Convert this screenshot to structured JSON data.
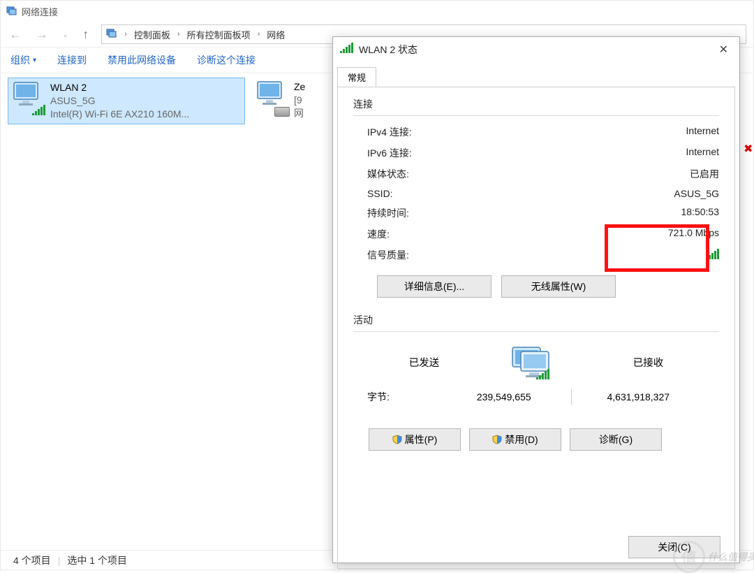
{
  "window": {
    "title": "网络连接",
    "breadcrumb": [
      "控制面板",
      "所有控制面板项",
      "网络"
    ]
  },
  "toolbar": {
    "organize": "组织",
    "connect": "连接到",
    "disable": "禁用此网络设备",
    "diagnose": "诊断这个连接"
  },
  "items": [
    {
      "name": "WLAN 2",
      "ssid": "ASUS_5G",
      "adapter": "Intel(R) Wi-Fi 6E AX210 160M...",
      "selected": true,
      "type": "wifi"
    },
    {
      "name": "Ze",
      "sub1": "[9",
      "sub2": "网",
      "selected": false,
      "type": "eth"
    }
  ],
  "status_bar": {
    "items": "4 个项目",
    "selected": "选中 1 个项目"
  },
  "dialog": {
    "title": "WLAN 2 状态",
    "tab": "常规",
    "sections": {
      "conn_title": "连接",
      "ipv4_k": "IPv4 连接:",
      "ipv4_v": "Internet",
      "ipv6_k": "IPv6 连接:",
      "ipv6_v": "Internet",
      "media_k": "媒体状态:",
      "media_v": "已启用",
      "ssid_k": "SSID:",
      "ssid_v": "ASUS_5G",
      "dur_k": "持续时间:",
      "dur_v": "18:50:53",
      "speed_k": "速度:",
      "speed_v": "721.0 Mbps",
      "sigq_k": "信号质量:",
      "details_btn": "详细信息(E)...",
      "wprops_btn": "无线属性(W)",
      "act_title": "活动",
      "sent": "已发送",
      "recv": "已接收",
      "bytes_lbl": "字节:",
      "bytes_sent": "239,549,655",
      "bytes_recv": "4,631,918,327",
      "props_btn": "属性(P)",
      "disable_btn": "禁用(D)",
      "diag_btn": "诊断(G)",
      "close_btn": "关闭(C)"
    }
  },
  "watermark": "什么值得买"
}
